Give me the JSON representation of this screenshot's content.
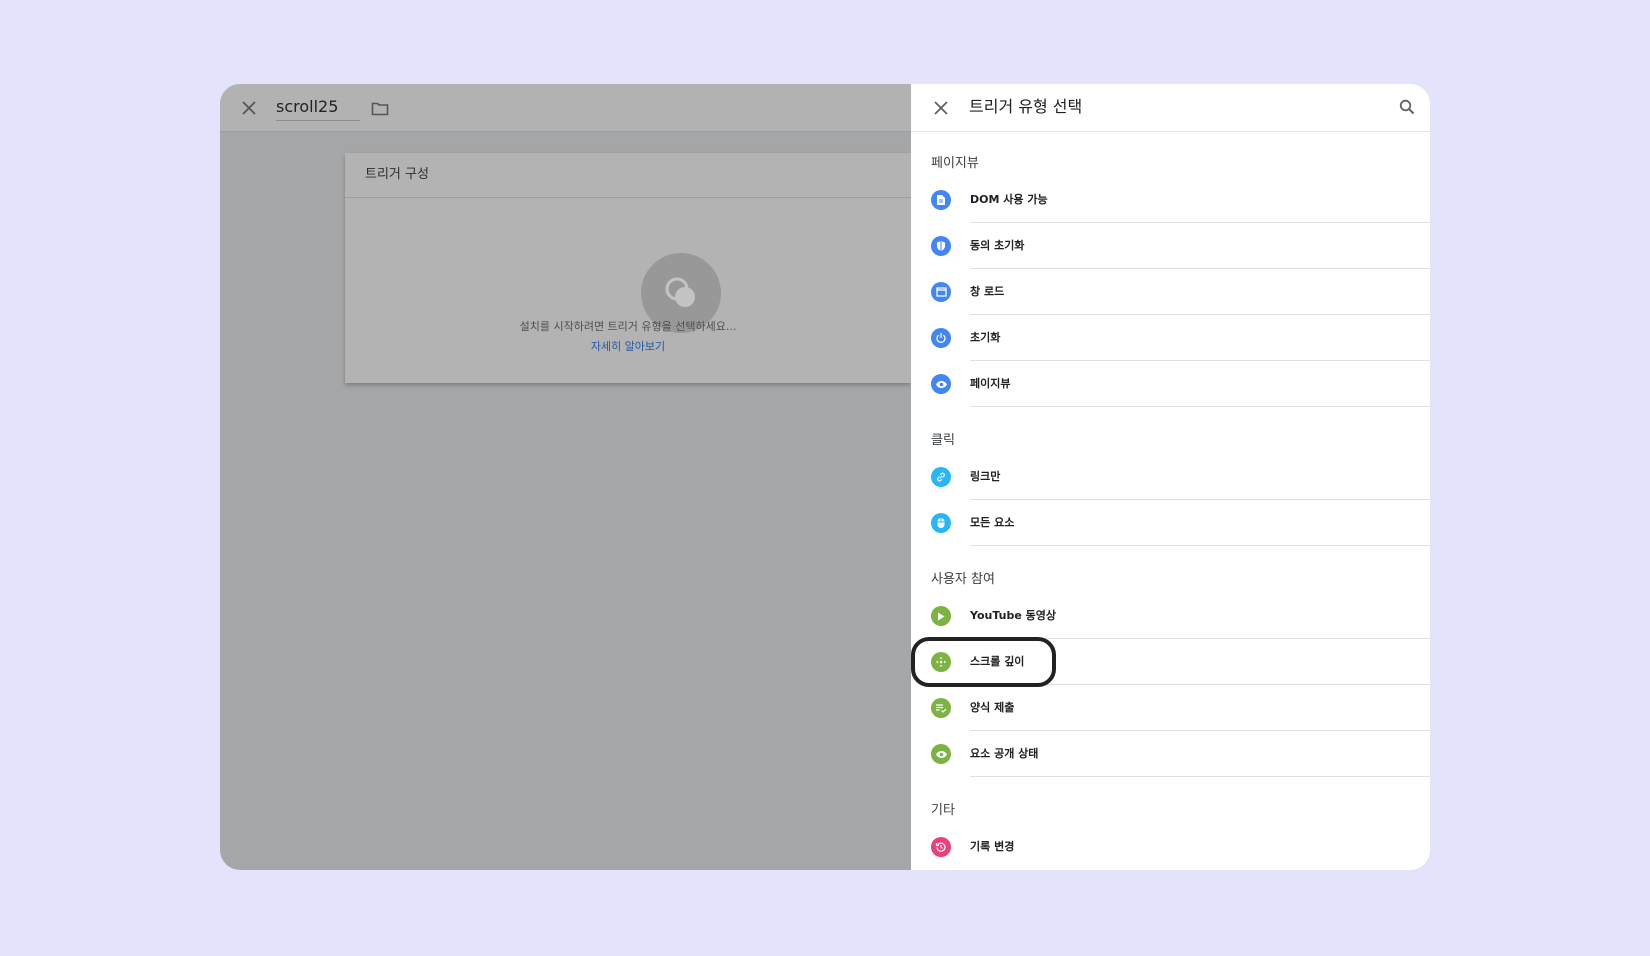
{
  "editor": {
    "name": "scroll25",
    "card_title": "트리거 구성",
    "hint": "설치를 시작하려면 트리거 유형을 선택하세요...",
    "learn_more": "자세히 알아보기"
  },
  "panel": {
    "title": "트리거 유형 선택",
    "sections": {
      "pageview": "페이지뷰",
      "click": "클릭",
      "engagement": "사용자 참여",
      "other": "기타"
    },
    "items": {
      "dom_ready": "DOM 사용 가능",
      "consent_init": "동의 초기화",
      "window_loaded": "창 로드",
      "initialization": "초기화",
      "page_view": "페이지뷰",
      "just_links": "링크만",
      "all_elements": "모든 요소",
      "youtube": "YouTube 동영상",
      "scroll_depth": "스크롤 깊이",
      "form_submit": "양식 제출",
      "element_visibility": "요소 공개 상태",
      "history_change": "기록 변경"
    }
  },
  "colors": {
    "pageview": "#4285f4",
    "click": "#29b6f6",
    "engagement": "#7cb342",
    "other": "#ec407a",
    "link": "#2457a8",
    "highlight": "#222222"
  },
  "icons": {
    "close": "close-icon",
    "folder": "folder-icon",
    "search": "search-icon",
    "dom_ready": "document-icon",
    "consent_init": "shield-icon",
    "window_loaded": "window-icon",
    "initialization": "power-icon",
    "page_view": "eye-icon",
    "just_links": "link-icon",
    "all_elements": "mouse-icon",
    "youtube": "play-icon",
    "scroll_depth": "move-arrows-icon",
    "form_submit": "form-check-icon",
    "element_visibility": "eye-icon",
    "history_change": "history-icon"
  }
}
